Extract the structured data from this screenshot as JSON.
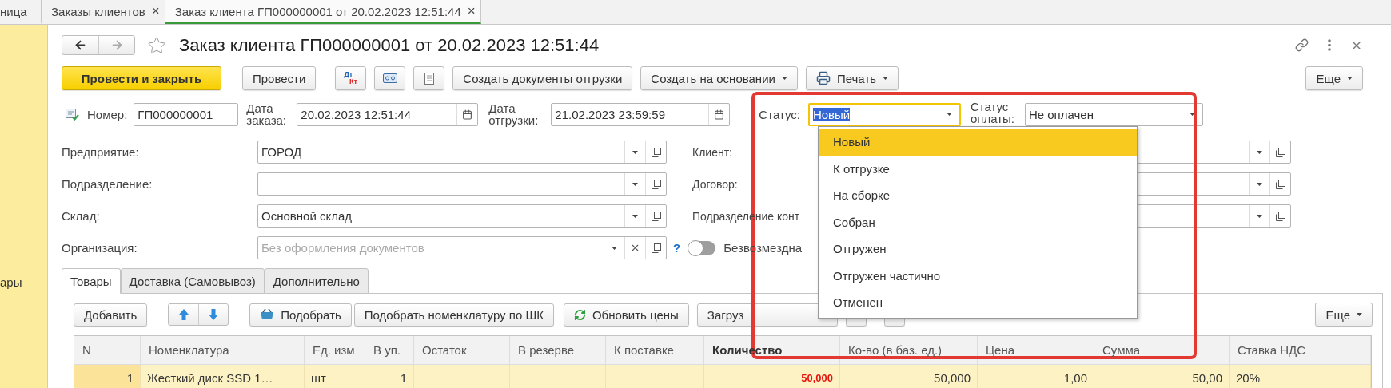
{
  "tabs": [
    {
      "label": "ница",
      "selected": false
    },
    {
      "label": "Заказы клиентов",
      "selected": false,
      "close": "×"
    },
    {
      "label": "Заказ клиента ГП000000001 от 20.02.2023 12:51:44",
      "selected": true,
      "close": "×"
    }
  ],
  "sidebar": {
    "items": [
      {
        "label": "ары",
        "selected": false
      }
    ]
  },
  "document": {
    "title": "Заказ клиента ГП000000001 от 20.02.2023 12:51:44",
    "favorite": false
  },
  "toolbar": {
    "buttons": [
      {
        "kind": "primary",
        "label": "Провести и закрыть"
      },
      {
        "kind": "text",
        "label": "Провести"
      },
      {
        "kind": "dtkt",
        "top": "Дт",
        "bottom": "Кт"
      },
      {
        "kind": "cassette"
      },
      {
        "kind": "list"
      },
      {
        "kind": "text",
        "label": "Создать документы отгрузки"
      },
      {
        "kind": "menu",
        "label": "Создать на основании"
      },
      {
        "kind": "print",
        "label": "Печать"
      }
    ],
    "more": "Еще"
  },
  "header_fields": {
    "number": {
      "label": "Номер:",
      "value": "ГП000000001"
    },
    "order_date": {
      "label": "Дата заказа:",
      "value": "20.02.2023 12:51:44"
    },
    "ship_date": {
      "label": "Дата отгрузки:",
      "value": "21.02.2023 23:59:59"
    },
    "status": {
      "label": "Статус:",
      "value": "Новый",
      "focused": true
    },
    "payment_status": {
      "label": "Статус оплаты:",
      "value": "Не оплачен"
    }
  },
  "left_fields": [
    {
      "label": "Предприятие:",
      "value": "ГОРОД",
      "clearable": false
    },
    {
      "label": "Подразделение:",
      "clearable": false
    },
    {
      "label": "Склад:",
      "value": "Основной склад",
      "clearable": false
    },
    {
      "label": "Организация:",
      "placeholder": "Без оформления документов",
      "clearable": true,
      "help": "?"
    }
  ],
  "right_fields": [
    {
      "label": "Клиент:"
    },
    {
      "label": "Договор:"
    },
    {
      "label": "Подразделение конт"
    }
  ],
  "toggle": {
    "label": "Безвозмездна",
    "on": false
  },
  "status_dropdown": {
    "items": [
      {
        "label": "Новый",
        "selected": true
      },
      {
        "label": "К отгрузке",
        "selected": false
      },
      {
        "label": "На сборке",
        "selected": false
      },
      {
        "label": "Собран",
        "selected": false
      },
      {
        "label": "Отгружен",
        "selected": false
      },
      {
        "label": "Отгружен частично",
        "selected": false
      },
      {
        "label": "Отменен",
        "selected": false
      }
    ]
  },
  "section_tabs": [
    {
      "label": "Товары",
      "selected": true
    },
    {
      "label": "Доставка (Самовывоз)",
      "selected": false
    },
    {
      "label": "Дополнительно",
      "selected": false
    }
  ],
  "table_toolbar": {
    "buttons": [
      {
        "kind": "text",
        "label": "Добавить"
      },
      {
        "kind": "updown"
      },
      {
        "kind": "basket",
        "label": "Подобрать"
      },
      {
        "kind": "text",
        "label": "Подобрать номенклатуру по ШК"
      },
      {
        "kind": "refresh",
        "label": "Обновить цены"
      },
      {
        "kind": "wide",
        "label": "Загруз"
      },
      {
        "kind": "small"
      },
      {
        "kind": "small"
      }
    ],
    "more": "Еще"
  },
  "table": {
    "columns": [
      {
        "label": "N",
        "kind": "number",
        "bold": false
      },
      {
        "label": "Номенклатура",
        "kind": "text",
        "bold": false
      },
      {
        "label": "Ед. изм",
        "kind": "text",
        "bold": false
      },
      {
        "label": "В уп.",
        "kind": "number",
        "bold": false
      },
      {
        "label": "Остаток",
        "kind": "number",
        "bold": false
      },
      {
        "label": "В резерве",
        "kind": "number",
        "bold": false
      },
      {
        "label": "К поставке",
        "kind": "number",
        "bold": false
      },
      {
        "label": "Количество",
        "kind": "number",
        "bold": true
      },
      {
        "label": "Ко-во (в баз. ед.)",
        "kind": "number",
        "bold": false
      },
      {
        "label": "Цена",
        "kind": "number",
        "bold": false
      },
      {
        "label": "Сумма",
        "kind": "number",
        "bold": false
      },
      {
        "label": "Ставка НДС",
        "kind": "text",
        "bold": false
      }
    ],
    "rows": [
      {
        "selected": true,
        "cells": [
          "1",
          "Жесткий диск SSD 1…",
          "шт",
          "1",
          "",
          "",
          "",
          "50,000",
          "50,000",
          "1,00",
          "50,00",
          "20%"
        ]
      }
    ]
  }
}
